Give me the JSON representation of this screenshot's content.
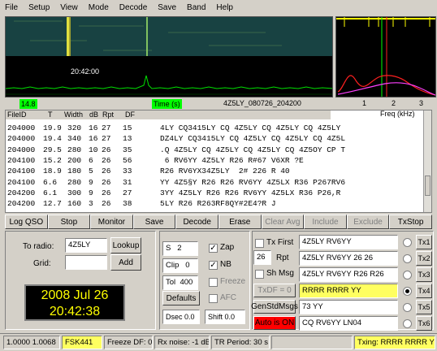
{
  "menu": [
    "File",
    "Setup",
    "View",
    "Mode",
    "Decode",
    "Save",
    "Band",
    "Help"
  ],
  "waterfall": {
    "timestamp": "20:42:00"
  },
  "status": {
    "left_value": "14.8",
    "time_label": "Time (s)",
    "file_name": "4Z5LY_080726_204200",
    "freq_ticks": [
      "1",
      "2",
      "3"
    ],
    "freq_label": "Freq (kHz)"
  },
  "decode_headers": [
    "FileID",
    "T",
    "Width",
    "dB",
    "Rpt",
    "DF"
  ],
  "decodes": [
    {
      "id": "204000",
      "t": "19.9",
      "w": "320",
      "db": "16",
      "rpt": "27",
      "df": "15",
      "msg": "4LY CQ3415LY CQ 4Z5LY CQ 4Z5LY CQ 4Z5LY"
    },
    {
      "id": "204000",
      "t": "19.4",
      "w": "340",
      "db": "16",
      "rpt": "27",
      "df": "13",
      "msg": "DZ4LY CQ3415LY CQ 4Z5LY CQ 4Z5LY CQ 4Z5L"
    },
    {
      "id": "204000",
      "t": "29.5",
      "w": "280",
      "db": "10",
      "rpt": "26",
      "df": "35",
      "msg": ".Q 4Z5LY CQ 4Z5LY CQ 4Z5LY CQ 4Z5OY CP T"
    },
    {
      "id": "204100",
      "t": "15.2",
      "w": "200",
      "db": "6",
      "rpt": "26",
      "df": "56",
      "msg": " 6 RV6YY 4Z5LY R26 R#67 V6XR ?E"
    },
    {
      "id": "204100",
      "t": "18.9",
      "w": "180",
      "db": "5",
      "rpt": "26",
      "df": "33",
      "msg": "R26 RV6YX34Z5LY  2# 226 R 40"
    },
    {
      "id": "204100",
      "t": "6.6",
      "w": "280",
      "db": "9",
      "rpt": "26",
      "df": "31",
      "msg": "YY 4Z5§Y R26 R26 RV6YY 4Z5LX R36 P267RV6"
    },
    {
      "id": "204200",
      "t": "6.1",
      "w": "300",
      "db": "9",
      "rpt": "26",
      "df": "27",
      "msg": "3YY 4Z5LY R26 R26 RV6YY 4Z5LX R36 P26,R"
    },
    {
      "id": "204200",
      "t": "12.7",
      "w": "160",
      "db": "3",
      "rpt": "26",
      "df": "38",
      "msg": "5LY R26 R263RF8QY#2E4?R J"
    }
  ],
  "buttons": {
    "log_qso": "Log QSO",
    "stop": "Stop",
    "monitor": "Monitor",
    "save": "Save",
    "decode": "Decode",
    "erase": "Erase",
    "clear_avg": "Clear Avg",
    "include": "Include",
    "exclude": "Exclude",
    "txstop": "TxStop"
  },
  "left_panel": {
    "to_radio_label": "To radio:",
    "to_radio_value": "4Z5LY",
    "lookup": "Lookup",
    "grid_label": "Grid:",
    "grid_value": "",
    "add": "Add",
    "date": "2008 Jul 26",
    "time": "20:42:38"
  },
  "mid_panel": {
    "s_label": "S",
    "s_value": "2",
    "zap": "Zap",
    "zap_checked": "✓",
    "clip_label": "Clip",
    "clip_value": "0",
    "nb": "NB",
    "nb_checked": "✓",
    "tol_label": "Tol",
    "tol_value": "400",
    "freeze": "Freeze",
    "defaults": "Defaults",
    "afc": "AFC",
    "dsec": "Dsec  0.0",
    "shift": "Shift 0.0"
  },
  "right_panel": {
    "tx_first": "Tx First",
    "rpt_value": "26",
    "rpt_label": "Rpt",
    "sh_msg": "Sh Msg",
    "txdf": "TxDF = 0",
    "gen_std": "GenStdMsgs",
    "auto": "Auto is ON",
    "messages": [
      "4Z5LY RV6YY",
      "4Z5LY RV6YY 26 26",
      "4Z5LY RV6YY R26 R26",
      "RRRR RRRR YY",
      "73 YY",
      "CQ RV6YY LN04"
    ],
    "tx_buttons": [
      "Tx1",
      "Tx2",
      "Tx3",
      "Tx4",
      "Tx5",
      "Tx6"
    ]
  },
  "statusbar": {
    "ratio": "1.0000 1.0068",
    "mode": "FSK441",
    "freeze": "Freeze DF:  0",
    "rx_noise": "Rx noise: -1 dB",
    "tr_period": "TR Period: 30 s",
    "txing": "Txing:  RRRR RRRR YY"
  },
  "colors": {
    "yellow": "#ffff80",
    "green": "#00ff00",
    "red": "#ff0000"
  }
}
